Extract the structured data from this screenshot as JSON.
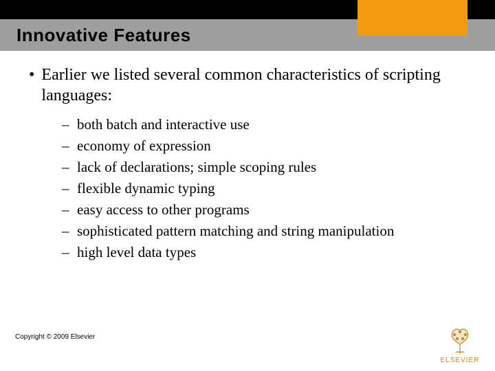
{
  "header": {
    "title": "Innovative Features"
  },
  "main": {
    "bullet": "Earlier we listed several common characteristics of scripting languages:",
    "subitems": [
      "both batch and interactive use",
      "economy of expression",
      "lack of declarations; simple scoping rules",
      "flexible dynamic typing",
      "easy access to other programs",
      "sophisticated pattern matching and string manipulation",
      "high level data types"
    ]
  },
  "footer": {
    "copyright": "Copyright © 2009 Elsevier",
    "logo_text": "ELSEVIER"
  }
}
